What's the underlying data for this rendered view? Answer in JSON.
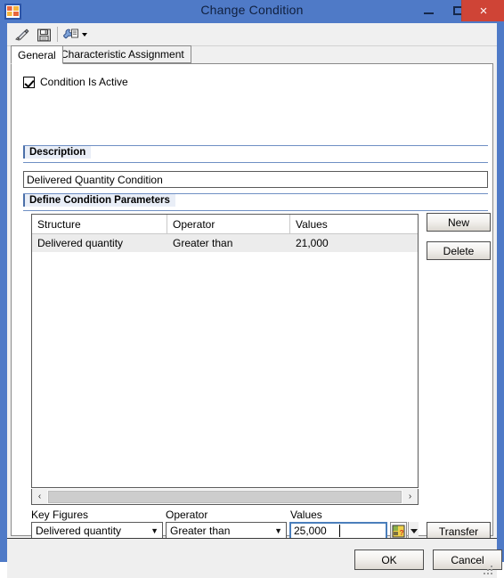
{
  "window": {
    "title": "Change Condition",
    "app_icon": "sap-app-icon",
    "controls": {
      "minimize": "minimize-icon",
      "maximize": "maximize-icon",
      "close": "×"
    }
  },
  "toolbar": {
    "items": [
      {
        "name": "check-pencil-icon",
        "tooltip": "Check"
      },
      {
        "name": "save-icon",
        "tooltip": "Save"
      },
      {
        "name": "tools-wrench-icon",
        "tooltip": "Tools",
        "has_dropdown": true
      }
    ]
  },
  "tabs": [
    {
      "label": "General",
      "active": true
    },
    {
      "label": "Characteristic Assignment",
      "active": false
    }
  ],
  "general": {
    "condition_active": {
      "label": "Condition Is Active",
      "checked": true
    },
    "description": {
      "group_title": "Description",
      "value": "Delivered Quantity Condition",
      "placeholder": ""
    },
    "parameters": {
      "group_title": "Define Condition Parameters",
      "columns": [
        "Structure",
        "Operator",
        "Values"
      ],
      "rows": [
        {
          "structure": "Delivered quantity",
          "operator": "Greater than",
          "values": "21,000"
        }
      ],
      "buttons": {
        "new": "New",
        "delete": "Delete"
      },
      "scrollbar": {
        "left_arrow": "‹",
        "right_arrow": "›"
      }
    },
    "editor": {
      "key_figures": {
        "label": "Key Figures",
        "value": "Delivered quantity"
      },
      "operator": {
        "label": "Operator",
        "value": "Greater than"
      },
      "values": {
        "label": "Values",
        "value": "25,000",
        "placeholder": ""
      },
      "value_help_icon": "value-help-icon",
      "transfer_button": "Transfer"
    }
  },
  "footer": {
    "ok": "OK",
    "cancel": "Cancel"
  },
  "colors": {
    "titlebar": "#4f7ac7",
    "close_button": "#cf4436",
    "group_rule": "#6f8fc4",
    "focus_border": "#4a7ebb",
    "row_selected": "#ececec"
  }
}
